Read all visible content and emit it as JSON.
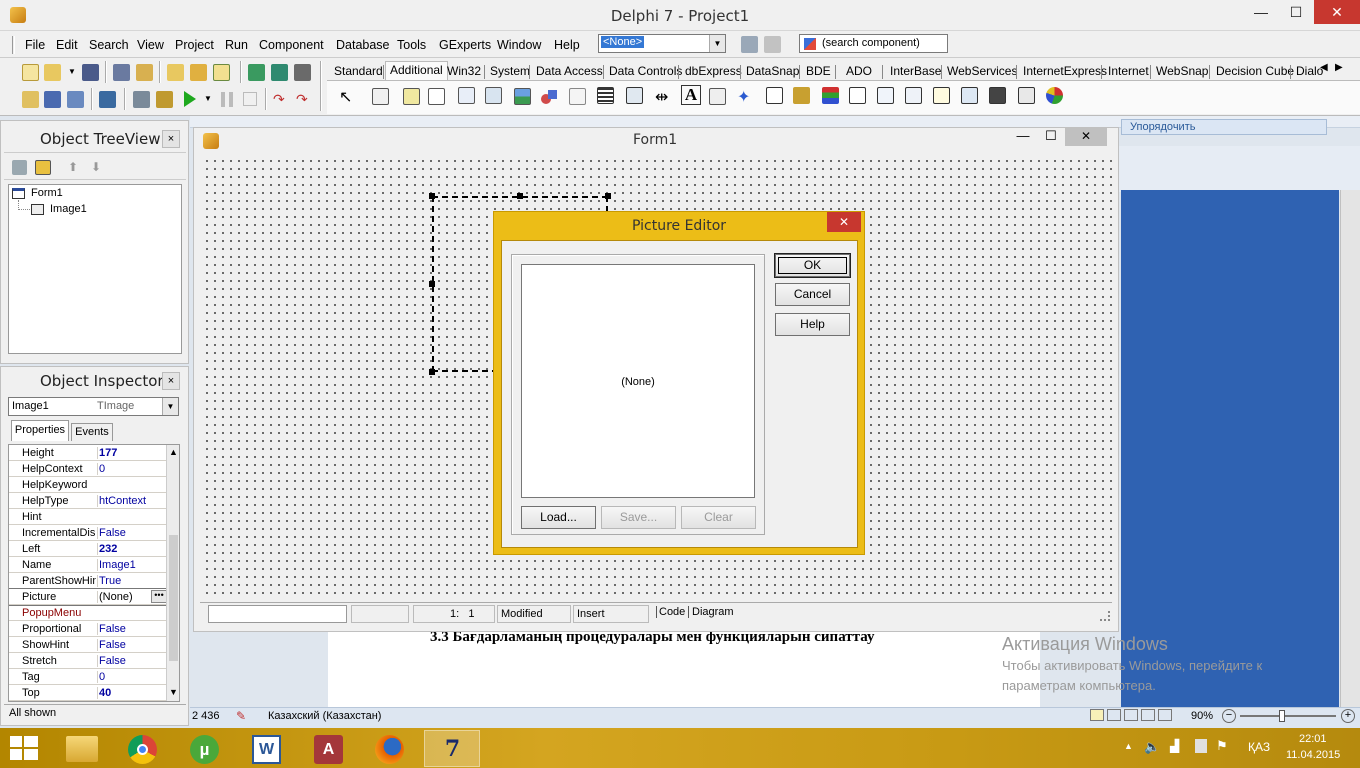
{
  "window": {
    "title": "Delphi 7 - Project1",
    "min": "—",
    "max": "☐",
    "close": "✕"
  },
  "menu": [
    "File",
    "Edit",
    "Search",
    "View",
    "Project",
    "Run",
    "Component",
    "Database",
    "Tools",
    "GExperts",
    "Window",
    "Help"
  ],
  "toolbar": {
    "desktop_combo": "<None>",
    "search_component": "(search component)"
  },
  "palette_tabs": [
    "Standard",
    "Additional",
    "Win32",
    "System",
    "Data Access",
    "Data Controls",
    "dbExpress",
    "DataSnap",
    "BDE",
    "ADO",
    "InterBase",
    "WebServices",
    "InternetExpress",
    "Internet",
    "WebSnap",
    "Decision Cube",
    "Dialo"
  ],
  "tree": {
    "title": "Object TreeView",
    "close": "×",
    "root": "Form1",
    "child": "Image1"
  },
  "inspector": {
    "title": "Object Inspector",
    "close": "×",
    "object_name": "Image1",
    "object_type": "TImage",
    "tab_properties": "Properties",
    "tab_events": "Events",
    "rows": [
      {
        "name": "Height",
        "value": "177",
        "bold": true
      },
      {
        "name": "HelpContext",
        "value": "0"
      },
      {
        "name": "HelpKeyword",
        "value": ""
      },
      {
        "name": "HelpType",
        "value": "htContext"
      },
      {
        "name": "Hint",
        "value": ""
      },
      {
        "name": "IncrementalDisp",
        "value": "False"
      },
      {
        "name": "Left",
        "value": "232",
        "bold": true
      },
      {
        "name": "Name",
        "value": "Image1"
      },
      {
        "name": "ParentShowHint",
        "value": "True"
      },
      {
        "name": "Picture",
        "value": "(None)",
        "selected": true
      },
      {
        "name": "PopupMenu",
        "value": "",
        "red": true
      },
      {
        "name": "Proportional",
        "value": "False"
      },
      {
        "name": "ShowHint",
        "value": "False"
      },
      {
        "name": "Stretch",
        "value": "False"
      },
      {
        "name": "Tag",
        "value": "0"
      },
      {
        "name": "Top",
        "value": "40",
        "bold": true
      }
    ],
    "footer": "All shown"
  },
  "form1": {
    "title": "Form1"
  },
  "picture_editor": {
    "title": "Picture Editor",
    "close": "✕",
    "preview": "(None)",
    "ok": "OK",
    "cancel": "Cancel",
    "help": "Help",
    "load": "Load...",
    "save": "Save...",
    "clear": "Clear"
  },
  "editor_status": {
    "position": "1:   1",
    "modified": "Modified",
    "insert": "Insert",
    "tab_code": "Code",
    "tab_diagram": "Diagram"
  },
  "word_bg": {
    "ribbon_button": "Упорядочить",
    "heading": "3.3 Бағдарламаның процедуралары мен функцияларын сипаттау",
    "activation_title": "Активация Windows",
    "activation_line1": "Чтобы активировать Windows, перейдите к",
    "activation_line2": "параметрам компьютера.",
    "status_words": "2 436",
    "status_lang": "Казахский (Казахстан)",
    "zoom": "90%"
  },
  "taskbar": {
    "lang": "ҚАЗ",
    "time": "22:01",
    "date": "11.04.2015"
  },
  "colors": {
    "dialog_frame": "#ecbd17",
    "close_red": "#c7372f",
    "value_blue": "#0000a0",
    "taskbar": "#c89a14"
  }
}
